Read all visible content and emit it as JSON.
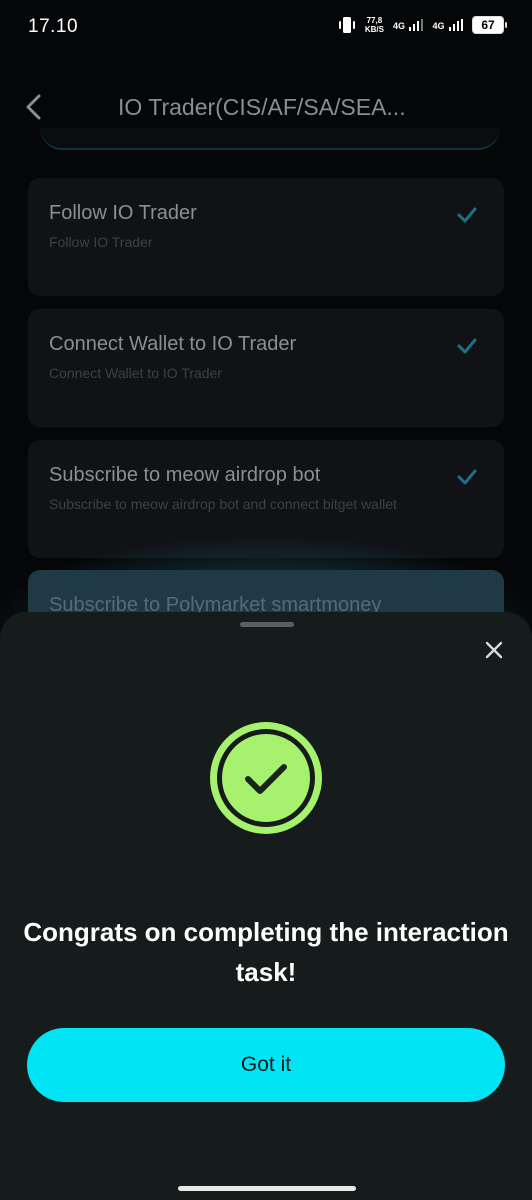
{
  "status_bar": {
    "time": "17.10",
    "net_speed_value": "77,8",
    "net_speed_unit": "KB/S",
    "sim1_label": "4G",
    "sim2_label": "4G",
    "battery": "67"
  },
  "header": {
    "title": "IO Trader(CIS/AF/SA/SEA..."
  },
  "tasks": [
    {
      "title": "Follow IO Trader",
      "subtitle": "Follow IO Trader",
      "completed": true
    },
    {
      "title": "Connect Wallet to IO Trader",
      "subtitle": "Connect Wallet to IO Trader",
      "completed": true
    },
    {
      "title": "Subscribe to meow airdrop bot",
      "subtitle": "Subscribe to meow airdrop bot and connect bitget wallet",
      "completed": true
    },
    {
      "title": "Subscribe to Polymarket smartmoney"
    }
  ],
  "sheet": {
    "message": "Congrats on completing the interaction task!",
    "button_label": "Got it"
  },
  "colors": {
    "accent": "#00e4f3",
    "success": "#a6f26f",
    "check_blue": "#1d6f86"
  }
}
